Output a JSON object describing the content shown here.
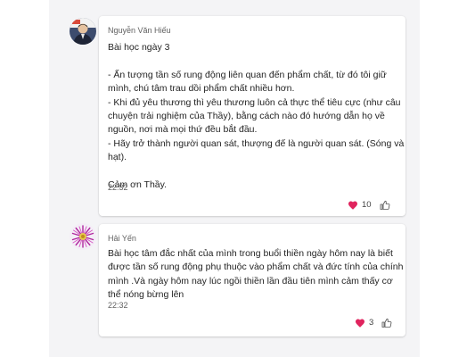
{
  "messages": [
    {
      "sender": "Nguyễn Văn Hiếu",
      "lines": [
        "Bài học ngày 3",
        "",
        "- Ấn tượng tần số rung động liên quan đến phẩm chất, từ đó tôi giữ",
        "mình, chú tâm trau dồi phẩm chất nhiều hơn.",
        "- Khi đủ yêu thương thì yêu thương luôn cả thực thể tiêu cực (như câu",
        "chuyện trải nghiệm của Thầy), bằng cách nào đó hướng dẫn họ về",
        "nguồn, nơi mà mọi thứ đều bắt đầu.",
        "- Hãy trở thành người quan sát, thượng đế là người quan sát. (Sóng và",
        "hạt).",
        "",
        "Cảm ơn Thầy."
      ],
      "time": "22:32",
      "reaction_count": "10",
      "reaction_icon": "heart-icon",
      "like_icon": "thumbs-up-icon"
    },
    {
      "sender": "Hải Yến",
      "lines": [
        "Bài học tâm đắc nhất của mình trong buổi thiền ngày hôm nay là biết",
        "được tần số rung động phụ thuộc vào phẩm chất và đức tính của chính",
        "mình .Và ngày hôm nay lúc ngồi thiền lần đầu tiên mình cảm thấy cơ",
        "thể nóng bừng lên"
      ],
      "time": "22:32",
      "reaction_count": "3",
      "reaction_icon": "heart-icon",
      "like_icon": "thumbs-up-icon"
    }
  ],
  "colors": {
    "heart": "#e0245e",
    "card_bg": "#ffffff",
    "page_bg": "#f4f4f6",
    "meta_text": "#616161"
  }
}
